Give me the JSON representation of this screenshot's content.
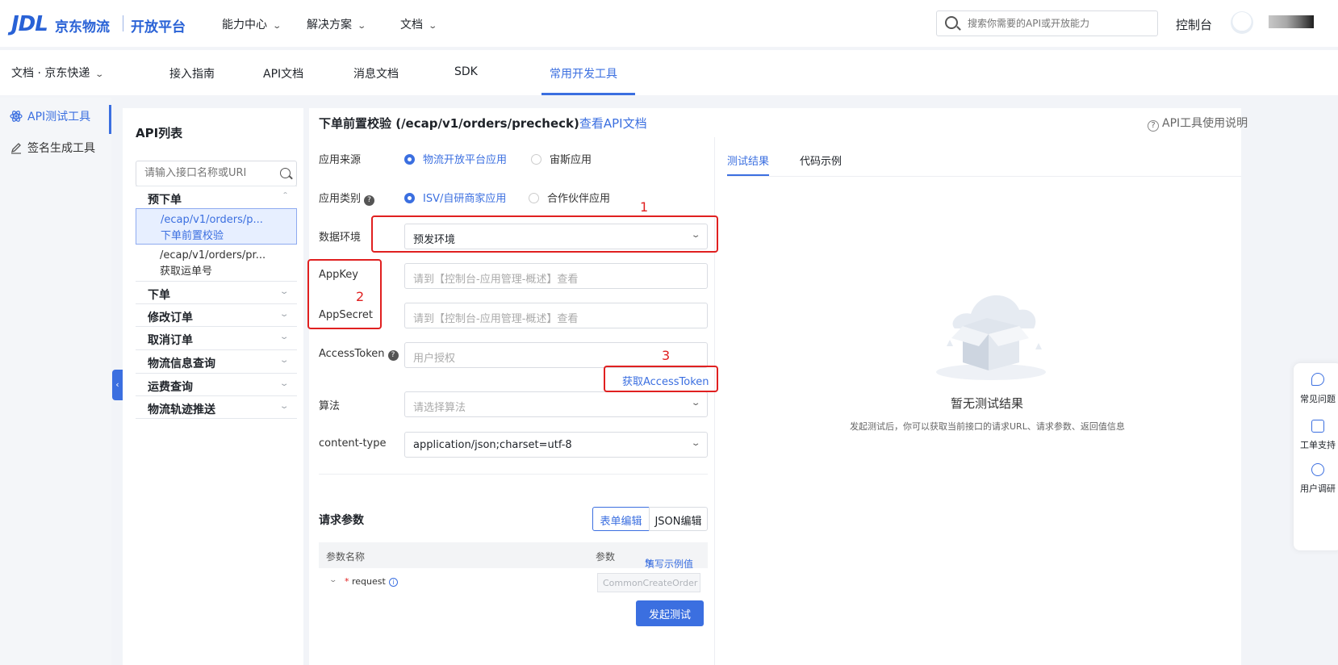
{
  "header": {
    "logo_mark": "JDL",
    "logo_brand": "京东物流",
    "logo_platform": "开放平台",
    "nav": [
      {
        "label": "能力中心"
      },
      {
        "label": "解决方案"
      },
      {
        "label": "文档"
      }
    ],
    "search_placeholder": "搜索你需要的API或开放能力",
    "console_label": "控制台"
  },
  "subnav": {
    "breadcrumb": "文档 · 京东快递",
    "tabs": [
      {
        "label": "接入指南"
      },
      {
        "label": "API文档"
      },
      {
        "label": "消息文档"
      },
      {
        "label": "SDK"
      },
      {
        "label": "常用开发工具",
        "active": true
      }
    ]
  },
  "sidebar": {
    "items": [
      {
        "label": "API测试工具",
        "active": true
      },
      {
        "label": "签名生成工具"
      }
    ]
  },
  "api_list": {
    "title": "API列表",
    "search_placeholder": "请输入接口名称或URI",
    "groups": [
      {
        "label": "预下单",
        "expanded": true,
        "items": [
          {
            "path": "/ecap/v1/orders/p...",
            "name": "下单前置校验",
            "selected": true
          },
          {
            "path": "/ecap/v1/orders/pr...",
            "name": "获取运单号"
          }
        ]
      },
      {
        "label": "下单"
      },
      {
        "label": "修改订单"
      },
      {
        "label": "取消订单"
      },
      {
        "label": "物流信息查询"
      },
      {
        "label": "运费查询"
      },
      {
        "label": "物流轨迹推送"
      }
    ]
  },
  "main": {
    "api_title": "下单前置校验 (/ecap/v1/orders/precheck)",
    "doc_link": "查看API文档",
    "help_link": "API工具使用说明",
    "form": {
      "app_source": {
        "label": "应用来源",
        "options": [
          {
            "label": "物流开放平台应用",
            "checked": true
          },
          {
            "label": "宙斯应用"
          }
        ]
      },
      "app_type": {
        "label": "应用类别",
        "options": [
          {
            "label": "ISV/自研商家应用",
            "checked": true
          },
          {
            "label": "合作伙伴应用"
          }
        ]
      },
      "env": {
        "label": "数据环境",
        "value": "预发环境"
      },
      "appkey": {
        "label": "AppKey",
        "placeholder": "请到【控制台-应用管理-概述】查看"
      },
      "appsecret": {
        "label": "AppSecret",
        "placeholder": "请到【控制台-应用管理-概述】查看"
      },
      "access_token": {
        "label": "AccessToken",
        "placeholder": "用户授权",
        "link": "获取AccessToken"
      },
      "algorithm": {
        "label": "算法",
        "placeholder": "请选择算法"
      },
      "content_type": {
        "label": "content-type",
        "value": "application/json;charset=utf-8"
      }
    },
    "annotations": [
      "1",
      "2",
      "3"
    ],
    "params": {
      "title": "请求参数",
      "modes": [
        {
          "label": "表单编辑",
          "active": true
        },
        {
          "label": "JSON编辑"
        }
      ],
      "col_name": "参数名称",
      "col_value": "参数",
      "fill_example": "填写示例值",
      "rows": [
        {
          "name": "request",
          "value": "CommonCreateOrder"
        }
      ]
    },
    "submit_label": "发起测试",
    "results": {
      "tabs": [
        {
          "label": "测试结果",
          "active": true
        },
        {
          "label": "代码示例"
        }
      ],
      "empty_title": "暂无测试结果",
      "empty_desc": "发起测试后，你可以获取当前接口的请求URL、请求参数、返回值信息"
    }
  },
  "dock": {
    "items": [
      {
        "label": "常见问题",
        "icon": "faq-icon"
      },
      {
        "label": "工单支持",
        "icon": "ticket-icon"
      },
      {
        "label": "用户调研",
        "icon": "survey-icon"
      }
    ]
  },
  "colors": {
    "accent": "#3b6fe0",
    "annotation": "#e02020"
  }
}
